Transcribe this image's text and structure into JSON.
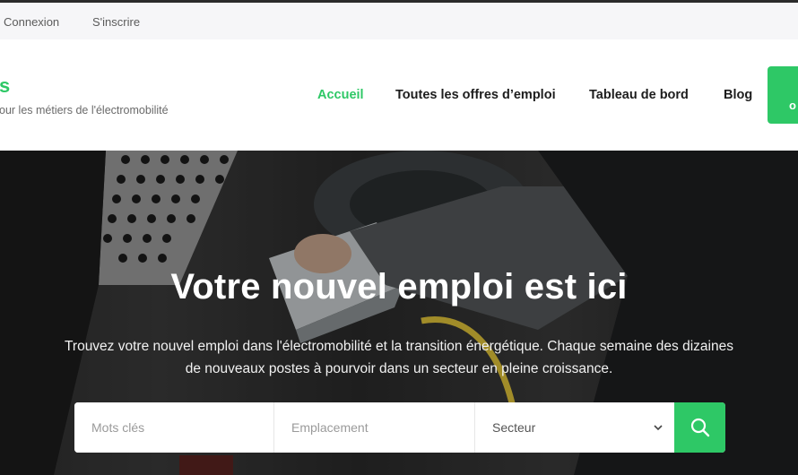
{
  "topbar": {
    "login_label": "Connexion",
    "signup_label": "S'inscrire"
  },
  "header": {
    "logo_fragment": "s",
    "tagline": "our les métiers de l'électromobilité",
    "nav": [
      {
        "label": "Accueil",
        "active": true
      },
      {
        "label": "Toutes les offres d’emploi"
      },
      {
        "label": "Tableau de bord"
      },
      {
        "label": "Blog"
      }
    ],
    "cta_fragment": "o"
  },
  "hero": {
    "title": "Votre nouvel emploi est ici",
    "subtitle": "Trouvez votre nouvel emploi dans l'électromobilité et la transition énergétique. Chaque semaine des dizaines de nouveaux postes à pourvoir dans un secteur en pleine croissance.",
    "background": "electric-vehicle-charging-photo"
  },
  "search": {
    "keywords_placeholder": "Mots clés",
    "location_placeholder": "Emplacement",
    "sector_value": "Secteur",
    "button_icon": "search-icon"
  },
  "colors": {
    "accent": "#2ec866",
    "topbar_bg": "#f6f6f8",
    "text_dark": "#1d1d1d"
  }
}
